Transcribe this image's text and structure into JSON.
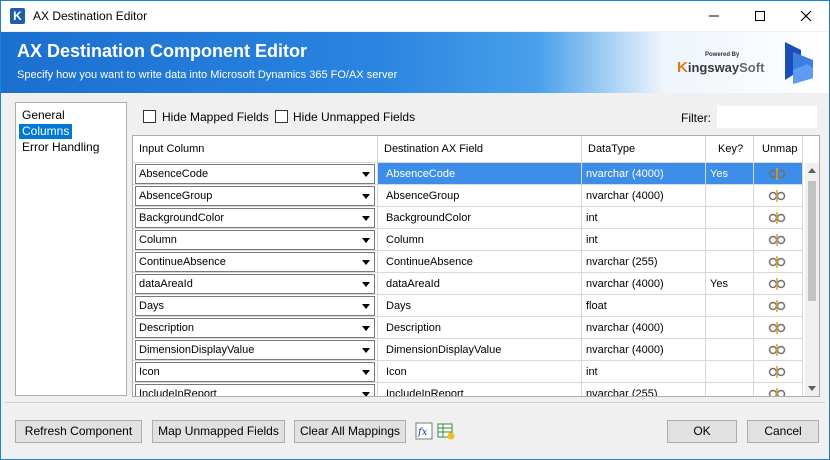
{
  "window": {
    "title": "AX Destination Editor",
    "app_icon": "K",
    "minimize_icon": "minimize-icon",
    "maximize_icon": "maximize-icon",
    "close_icon": "close-icon"
  },
  "banner": {
    "title": "AX Destination Component Editor",
    "subtitle": "Specify how you want to write data into Microsoft Dynamics 365 FO/AX server",
    "logo_powered": "Powered By",
    "logo_k": "K",
    "logo_ingsway": "ingsway",
    "logo_soft": "Soft"
  },
  "nav": {
    "items": [
      {
        "label": "General"
      },
      {
        "label": "Columns"
      },
      {
        "label": "Error Handling"
      }
    ],
    "selected": "Columns"
  },
  "toolbar": {
    "hide_mapped": "Hide Mapped Fields",
    "hide_unmapped": "Hide Unmapped Fields",
    "filter_label": "Filter:",
    "filter_value": ""
  },
  "grid": {
    "headers": {
      "input": "Input Column",
      "dest": "Destination AX Field",
      "type": "DataType",
      "key": "Key?",
      "unmap": "Unmap"
    },
    "rows": [
      {
        "input": "AbsenceCode",
        "dest": "AbsenceCode",
        "type": "nvarchar (4000)",
        "key": "Yes"
      },
      {
        "input": "AbsenceGroup",
        "dest": "AbsenceGroup",
        "type": "nvarchar (4000)",
        "key": ""
      },
      {
        "input": "BackgroundColor",
        "dest": "BackgroundColor",
        "type": "int",
        "key": ""
      },
      {
        "input": "Column",
        "dest": "Column",
        "type": "int",
        "key": ""
      },
      {
        "input": "ContinueAbsence",
        "dest": "ContinueAbsence",
        "type": "nvarchar (255)",
        "key": ""
      },
      {
        "input": "dataAreaId",
        "dest": "dataAreaId",
        "type": "nvarchar (4000)",
        "key": "Yes"
      },
      {
        "input": "Days",
        "dest": "Days",
        "type": "float",
        "key": ""
      },
      {
        "input": "Description",
        "dest": "Description",
        "type": "nvarchar (4000)",
        "key": ""
      },
      {
        "input": "DimensionDisplayValue",
        "dest": "DimensionDisplayValue",
        "type": "nvarchar (4000)",
        "key": ""
      },
      {
        "input": "Icon",
        "dest": "Icon",
        "type": "int",
        "key": ""
      },
      {
        "input": "IncludeInReport",
        "dest": "IncludeInReport",
        "type": "nvarchar (255)",
        "key": ""
      }
    ],
    "selected_row": 0
  },
  "buttons": {
    "refresh": "Refresh Component",
    "map_unmapped": "Map Unmapped Fields",
    "clear_all": "Clear All Mappings",
    "ok": "OK",
    "cancel": "Cancel"
  },
  "colors": {
    "accent": "#0078d7",
    "banner": "#1b6fd0",
    "selected_row": "#3d8ee8"
  }
}
